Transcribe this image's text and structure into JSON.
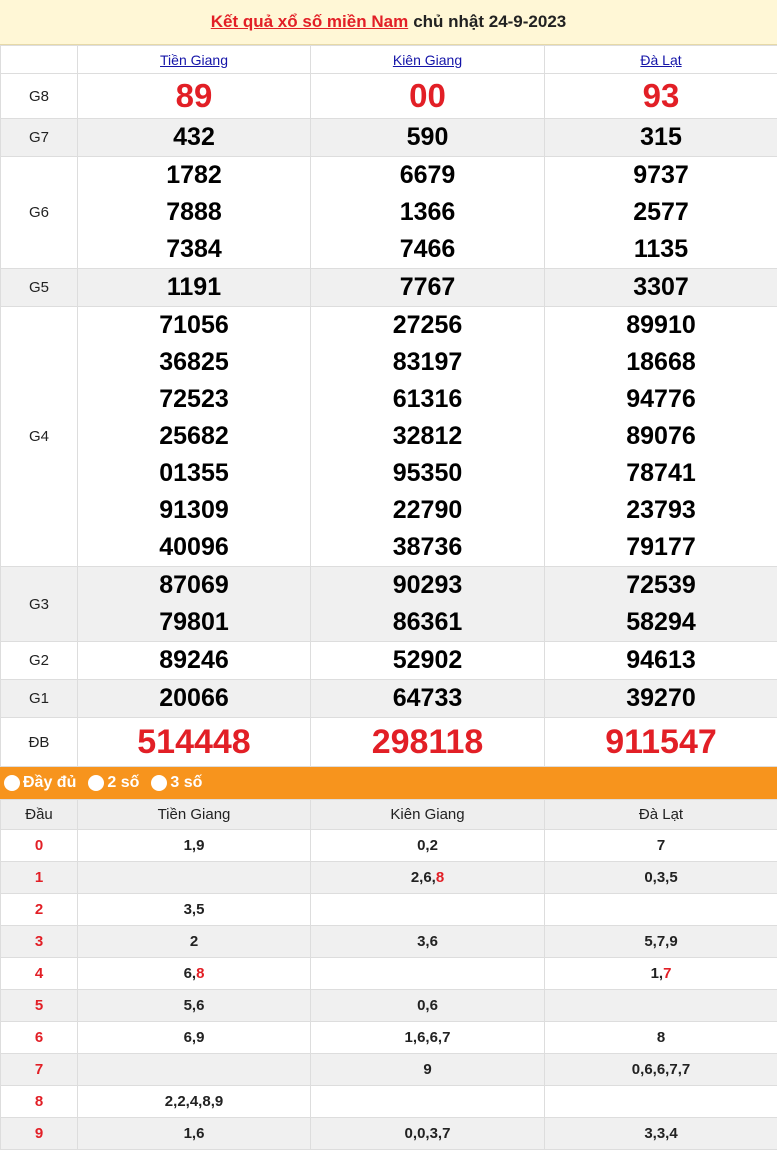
{
  "title": {
    "link_text": "Kết quả xổ số miền Nam",
    "rest_text": "chủ nhật 24-9-2023"
  },
  "provinces": [
    "Tiền Giang",
    "Kiên Giang",
    "Đà Lạt"
  ],
  "prizes": [
    {
      "label": "G8",
      "values": [
        [
          "89"
        ],
        [
          "00"
        ],
        [
          "93"
        ]
      ]
    },
    {
      "label": "G7",
      "values": [
        [
          "432"
        ],
        [
          "590"
        ],
        [
          "315"
        ]
      ]
    },
    {
      "label": "G6",
      "values": [
        [
          "1782",
          "7888",
          "7384"
        ],
        [
          "6679",
          "1366",
          "7466"
        ],
        [
          "9737",
          "2577",
          "1135"
        ]
      ]
    },
    {
      "label": "G5",
      "values": [
        [
          "1191"
        ],
        [
          "7767"
        ],
        [
          "3307"
        ]
      ]
    },
    {
      "label": "G4",
      "values": [
        [
          "71056",
          "36825",
          "72523",
          "25682",
          "01355",
          "91309",
          "40096"
        ],
        [
          "27256",
          "83197",
          "61316",
          "32812",
          "95350",
          "22790",
          "38736"
        ],
        [
          "89910",
          "18668",
          "94776",
          "89076",
          "78741",
          "23793",
          "79177"
        ]
      ]
    },
    {
      "label": "G3",
      "values": [
        [
          "87069",
          "79801"
        ],
        [
          "90293",
          "86361"
        ],
        [
          "72539",
          "58294"
        ]
      ]
    },
    {
      "label": "G2",
      "values": [
        [
          "89246"
        ],
        [
          "52902"
        ],
        [
          "94613"
        ]
      ]
    },
    {
      "label": "G1",
      "values": [
        [
          "20066"
        ],
        [
          "64733"
        ],
        [
          "39270"
        ]
      ]
    },
    {
      "label": "ĐB",
      "values": [
        [
          "514448"
        ],
        [
          "298118"
        ],
        [
          "911547"
        ]
      ]
    }
  ],
  "modes": [
    "Đầy đủ",
    "2 số",
    "3 số"
  ],
  "loto": {
    "header_dau": "Đầu",
    "rows": [
      {
        "dau": "0",
        "cells": [
          [
            "1",
            "9"
          ],
          [
            "0",
            "2"
          ],
          [
            "7"
          ]
        ]
      },
      {
        "dau": "1",
        "cells": [
          [],
          [
            "2",
            "6",
            "8*"
          ],
          [
            "0",
            "3",
            "5"
          ]
        ]
      },
      {
        "dau": "2",
        "cells": [
          [
            "3",
            "5"
          ],
          [],
          []
        ]
      },
      {
        "dau": "3",
        "cells": [
          [
            "2"
          ],
          [
            "3",
            "6"
          ],
          [
            "5",
            "7",
            "9"
          ]
        ]
      },
      {
        "dau": "4",
        "cells": [
          [
            "6",
            "8*"
          ],
          [],
          [
            "1",
            "7*"
          ]
        ]
      },
      {
        "dau": "5",
        "cells": [
          [
            "5",
            "6"
          ],
          [
            "0",
            "6"
          ],
          []
        ]
      },
      {
        "dau": "6",
        "cells": [
          [
            "6",
            "9"
          ],
          [
            "1",
            "6",
            "6",
            "7"
          ],
          [
            "8"
          ]
        ]
      },
      {
        "dau": "7",
        "cells": [
          [],
          [
            "9"
          ],
          [
            "0",
            "6",
            "6",
            "7",
            "7"
          ]
        ]
      },
      {
        "dau": "8",
        "cells": [
          [
            "2",
            "2",
            "4",
            "8",
            "9"
          ],
          [],
          []
        ]
      },
      {
        "dau": "9",
        "cells": [
          [
            "1",
            "6"
          ],
          [
            "0",
            "0",
            "3",
            "7"
          ],
          [
            "3",
            "3",
            "4"
          ]
        ]
      }
    ]
  },
  "colors": {
    "accent_red": "#e21f26",
    "orange_bar": "#f7941d",
    "title_bg": "#fff7d6",
    "link_blue": "#1414a8"
  }
}
